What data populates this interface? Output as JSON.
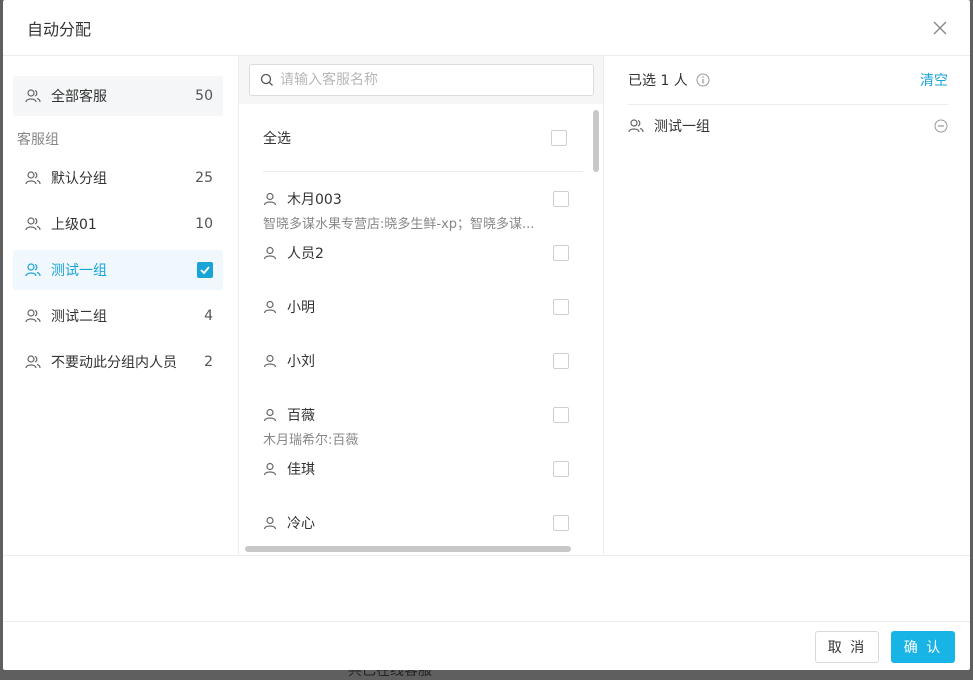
{
  "backdrop": {
    "bottom_text": "共已在线客服"
  },
  "modal": {
    "title": "自动分配"
  },
  "left": {
    "all_item": {
      "label": "全部客服",
      "count": "50"
    },
    "section_label": "客服组",
    "groups": [
      {
        "label": "默认分组",
        "count": "25",
        "checked": false
      },
      {
        "label": "上级01",
        "count": "10",
        "checked": false
      },
      {
        "label": "测试一组",
        "count": "",
        "checked": true
      },
      {
        "label": "测试二组",
        "count": "4",
        "checked": false
      },
      {
        "label": "不要动此分组内人员",
        "count": "2",
        "checked": false
      }
    ]
  },
  "middle": {
    "search_placeholder": "请输入客服名称",
    "select_all_label": "全选",
    "people": [
      {
        "name": "木月003",
        "sub": "智晓多谋水果专营店:晓多生鲜-xp；智晓多谋..."
      },
      {
        "name": "人员2",
        "sub": ""
      },
      {
        "name": "小明",
        "sub": ""
      },
      {
        "name": "小刘",
        "sub": ""
      },
      {
        "name": "百薇",
        "sub": "木月瑞希尔:百薇"
      },
      {
        "name": "佳琪",
        "sub": ""
      },
      {
        "name": "冷心",
        "sub": ""
      }
    ]
  },
  "right": {
    "selected_count": "已选 1 人",
    "clear_label": "清空",
    "selected_items": [
      {
        "label": "测试一组"
      }
    ]
  },
  "footer": {
    "cancel_label": "取 消",
    "ok_label": "确 认"
  },
  "colors": {
    "accent": "#19a4d6",
    "primary_button": "#19b4e6"
  }
}
